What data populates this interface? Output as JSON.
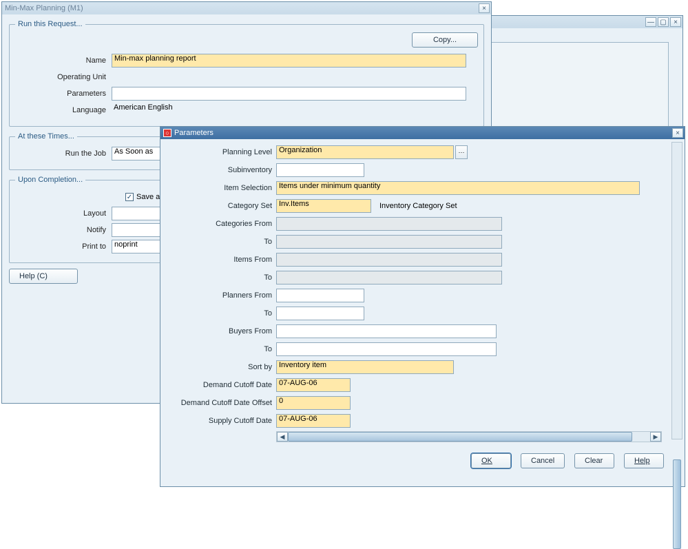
{
  "back_window": {
    "title": ""
  },
  "main_window": {
    "title": "Min-Max Planning (M1)",
    "group_run": {
      "legend": "Run this Request...",
      "copy_btn": "Copy...",
      "name_label": "Name",
      "name_value": "Min-max planning report",
      "operating_unit_label": "Operating Unit",
      "operating_unit_value": "",
      "parameters_label": "Parameters",
      "parameters_value": "",
      "language_label": "Language",
      "language_value": "American English"
    },
    "group_times": {
      "legend": "At these Times...",
      "run_job_label": "Run the Job",
      "run_job_value": "As Soon as"
    },
    "group_completion": {
      "legend": "Upon Completion...",
      "save_all_label": "Save all Ou",
      "layout_label": "Layout",
      "layout_value": "",
      "notify_label": "Notify",
      "notify_value": "",
      "print_to_label": "Print to",
      "print_to_value": "noprint"
    },
    "help_btn": "Help (C)"
  },
  "params_dialog": {
    "title": "Parameters",
    "fields": {
      "planning_level_label": "Planning Level",
      "planning_level_value": "Organization",
      "subinventory_label": "Subinventory",
      "subinventory_value": "",
      "item_selection_label": "Item Selection",
      "item_selection_value": "Items under minimum quantity",
      "category_set_label": "Category Set",
      "category_set_value": "Inv.Items",
      "category_set_desc": "Inventory Category Set",
      "categories_from_label": "Categories From",
      "categories_from_value": "",
      "categories_to_label": "To",
      "categories_to_value": "",
      "items_from_label": "Items From",
      "items_from_value": "",
      "items_to_label": "To",
      "items_to_value": "",
      "planners_from_label": "Planners From",
      "planners_from_value": "",
      "planners_to_label": "To",
      "planners_to_value": "",
      "buyers_from_label": "Buyers From",
      "buyers_from_value": "",
      "buyers_to_label": "To",
      "buyers_to_value": "",
      "sort_by_label": "Sort by",
      "sort_by_value": "Inventory item",
      "demand_cutoff_label": "Demand Cutoff Date",
      "demand_cutoff_value": "07-AUG-06",
      "demand_cutoff_offset_label": "Demand Cutoff Date Offset",
      "demand_cutoff_offset_value": "0",
      "supply_cutoff_label": "Supply Cutoff Date",
      "supply_cutoff_value": "07-AUG-06"
    },
    "buttons": {
      "ok": "OK",
      "cancel": "Cancel",
      "clear": "Clear",
      "help": "Help"
    }
  }
}
